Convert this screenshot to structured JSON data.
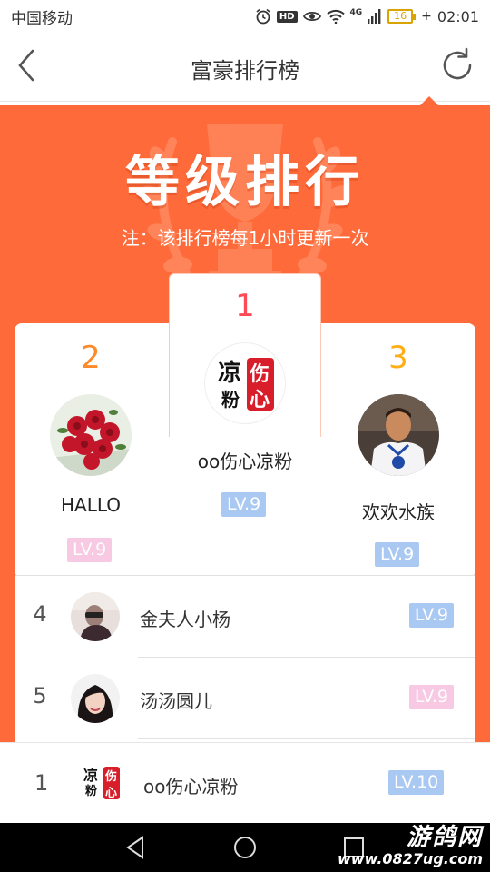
{
  "status_bar": {
    "carrier": "中国移动",
    "hd": "HD",
    "network": "4G",
    "battery": "16",
    "time": "02:01"
  },
  "header": {
    "title": "富豪排行榜",
    "back_icon": "back-chevron-icon",
    "refresh_icon": "refresh-icon"
  },
  "banner": {
    "title": "等级排行",
    "note": "注：该排行榜每1小时更新一次",
    "background": "#fe6a3a"
  },
  "podium": {
    "first": {
      "rank": "1",
      "name": "oo伤心凉粉",
      "level": "LV.9",
      "rank_color": "#fe4a55",
      "badge_color": "#a9c8f2",
      "avatar_chars": [
        "凉",
        "伤",
        "粉",
        "心"
      ]
    },
    "second": {
      "rank": "2",
      "name": "HALLO",
      "level": "LV.9",
      "rank_color": "#ff8a2b",
      "badge_color": "#f8c9e3"
    },
    "third": {
      "rank": "3",
      "name": "欢欢水族",
      "level": "LV.9",
      "rank_color": "#ffae15",
      "badge_color": "#a9c8f2"
    }
  },
  "list": [
    {
      "rank": "4",
      "name": "金夫人小杨",
      "level": "LV.9",
      "badge_color": "#a9c8f2"
    },
    {
      "rank": "5",
      "name": "汤汤圆儿",
      "level": "LV.9",
      "badge_color": "#f8c9e3"
    }
  ],
  "my_rank": {
    "rank": "1",
    "name": "oo伤心凉粉",
    "level": "LV.10",
    "badge_color": "#a9c8f2",
    "avatar_chars": [
      "凉",
      "伤",
      "粉",
      "心"
    ]
  },
  "watermark": {
    "line1": "游鸽网",
    "line2": "www.0827ug.com"
  }
}
